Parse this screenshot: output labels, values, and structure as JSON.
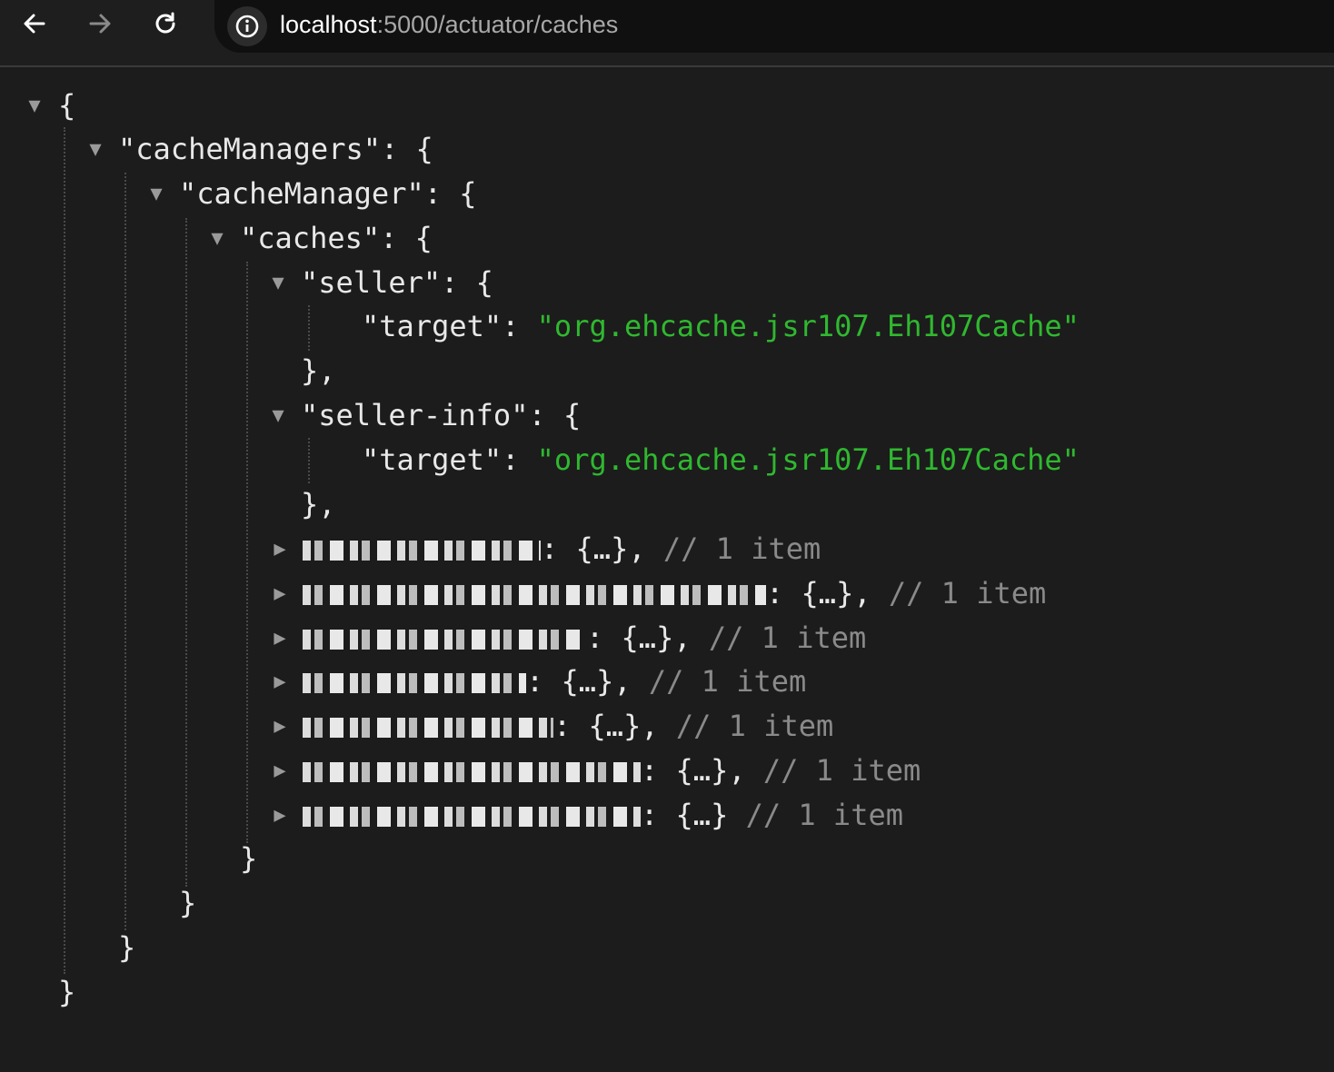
{
  "browser": {
    "url_host": "localhost",
    "url_rest": ":5000/actuator/caches"
  },
  "json": {
    "open_brace": "{",
    "close_brace": "}",
    "cacheManagers_line": "\"cacheManagers\": {",
    "cacheManager_line": "\"cacheManager\": {",
    "caches_line": "\"caches\": {",
    "seller_line": "\"seller\": {",
    "seller_info_line": "\"seller-info\": {",
    "target_key": "\"target\": ",
    "target_value": "\"org.ehcache.jsr107.Eh107Cache\"",
    "close_comma": "},",
    "collapsed_suffix_comma": ": {…},",
    "collapsed_suffix_last": ": {…}",
    "item_comment": "// 1 item"
  },
  "colors": {
    "background": "#1c1c1c",
    "string": "#2fb82f",
    "comment": "#8a8a8a"
  }
}
